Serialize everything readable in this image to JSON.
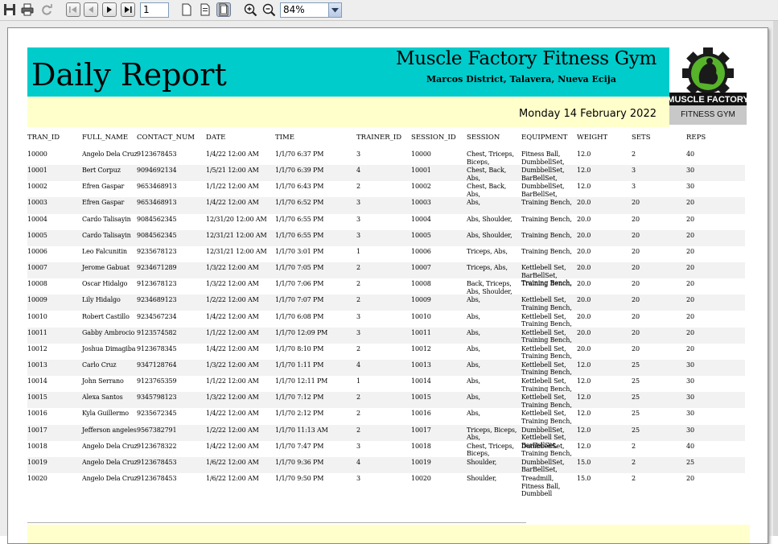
{
  "toolbar": {
    "page_number": "1",
    "zoom": "84%"
  },
  "report": {
    "title": "Daily Report",
    "gym_name": "Muscle Factory Fitness Gym",
    "address": "Marcos District, Talavera, Nueva Ecija",
    "date": "Monday 14 February 2022",
    "logo_text_1": "MUSCLE FACTORY",
    "logo_text_2": "FITNESS GYM"
  },
  "columns": [
    "TRAN_ID",
    "FULL_NAME",
    "CONTACT_NUM",
    "DATE",
    "TIME",
    "TRAINER_ID",
    "SESSION_ID",
    "SESSION",
    "EQUIPMENT",
    "WEIGHT",
    "SETS",
    "REPS"
  ],
  "rows": [
    {
      "id": "10000",
      "name": "Angelo Dela Cruz",
      "contact": "9123678453",
      "date": "1/4/22 12:00 AM",
      "time": "1/1/70 6:37 PM",
      "trainer": "3",
      "session_id": "10000",
      "session": "Chest, Triceps, Biceps,",
      "equipment": "Fitness Ball, DumbbellSet, Training Bench,",
      "weight": "12.0",
      "sets": "2",
      "reps": "40"
    },
    {
      "id": "10001",
      "name": "Bert Corpuz",
      "contact": "9094692134",
      "date": "1/5/21 12:00 AM",
      "time": "1/1/70 6:39 PM",
      "trainer": "4",
      "session_id": "10001",
      "session": "Chest, Back, Abs,",
      "equipment": "DumbbellSet, BarBellSet,",
      "weight": "12.0",
      "sets": "3",
      "reps": "30"
    },
    {
      "id": "10002",
      "name": "Efren Gaspar",
      "contact": "9653468913",
      "date": "1/1/22 12:00 AM",
      "time": "1/1/70 6:43 PM",
      "trainer": "2",
      "session_id": "10002",
      "session": "Chest, Back, Abs,",
      "equipment": "DumbbellSet, BarBellSet,",
      "weight": "12.0",
      "sets": "3",
      "reps": "30"
    },
    {
      "id": "10003",
      "name": "Efren Gaspar",
      "contact": "9653468913",
      "date": "1/4/22 12:00 AM",
      "time": "1/1/70 6:52 PM",
      "trainer": "3",
      "session_id": "10003",
      "session": "Abs,",
      "equipment": "Training Bench,",
      "weight": "20.0",
      "sets": "20",
      "reps": "20"
    },
    {
      "id": "10004",
      "name": "Cardo Talisayin",
      "contact": "9084562345",
      "date": "12/31/20 12:00 AM",
      "time": "1/1/70 6:55 PM",
      "trainer": "3",
      "session_id": "10004",
      "session": "Abs, Shoulder,",
      "equipment": "Training Bench,",
      "weight": "20.0",
      "sets": "20",
      "reps": "20"
    },
    {
      "id": "10005",
      "name": "Cardo Talisayin",
      "contact": "9084562345",
      "date": "12/31/21 12:00 AM",
      "time": "1/1/70 6:55 PM",
      "trainer": "3",
      "session_id": "10005",
      "session": "Abs, Shoulder,",
      "equipment": "Training Bench,",
      "weight": "20.0",
      "sets": "20",
      "reps": "20"
    },
    {
      "id": "10006",
      "name": "Leo Falcunitin",
      "contact": "9235678123",
      "date": "12/31/21 12:00 AM",
      "time": "1/1/70 3:01 PM",
      "trainer": "1",
      "session_id": "10006",
      "session": "Triceps, Abs,",
      "equipment": "Training Bench,",
      "weight": "20.0",
      "sets": "20",
      "reps": "20"
    },
    {
      "id": "10007",
      "name": "Jerome Gabuat",
      "contact": "9234671289",
      "date": "1/3/22 12:00 AM",
      "time": "1/1/70 7:05 PM",
      "trainer": "2",
      "session_id": "10007",
      "session": "Triceps, Abs,",
      "equipment": "Kettlebell Set, BarBellSet, Training Bench,",
      "weight": "20.0",
      "sets": "20",
      "reps": "20"
    },
    {
      "id": "10008",
      "name": "Oscar Hidalgo",
      "contact": "9123678123",
      "date": "1/3/22 12:00 AM",
      "time": "1/1/70 7:06 PM",
      "trainer": "2",
      "session_id": "10008",
      "session": "Back, Triceps, Abs, Shoulder,",
      "equipment": "Training Bench,",
      "weight": "20.0",
      "sets": "20",
      "reps": "20"
    },
    {
      "id": "10009",
      "name": "Lily Hidalgo",
      "contact": "9234689123",
      "date": "1/2/22 12:00 AM",
      "time": "1/1/70 7:07 PM",
      "trainer": "2",
      "session_id": "10009",
      "session": "Abs,",
      "equipment": "Kettlebell Set, Training Bench,",
      "weight": "20.0",
      "sets": "20",
      "reps": "20"
    },
    {
      "id": "10010",
      "name": "Robert Castillo",
      "contact": "9234567234",
      "date": "1/4/22 12:00 AM",
      "time": "1/1/70 6:08 PM",
      "trainer": "3",
      "session_id": "10010",
      "session": "Abs,",
      "equipment": "Kettlebell Set, Training Bench,",
      "weight": "20.0",
      "sets": "20",
      "reps": "20"
    },
    {
      "id": "10011",
      "name": "Gabby Ambrocio",
      "contact": "9123574582",
      "date": "1/1/22 12:00 AM",
      "time": "1/1/70 12:09 PM",
      "trainer": "3",
      "session_id": "10011",
      "session": "Abs,",
      "equipment": "Kettlebell Set, Training Bench,",
      "weight": "20.0",
      "sets": "20",
      "reps": "20"
    },
    {
      "id": "10012",
      "name": "Joshua Dimagiba",
      "contact": "9123678345",
      "date": "1/4/22 12:00 AM",
      "time": "1/1/70 8:10 PM",
      "trainer": "2",
      "session_id": "10012",
      "session": "Abs,",
      "equipment": "Kettlebell Set, Training Bench,",
      "weight": "20.0",
      "sets": "20",
      "reps": "20"
    },
    {
      "id": "10013",
      "name": "Carlo Cruz",
      "contact": "9347128764",
      "date": "1/3/22 12:00 AM",
      "time": "1/1/70 1:11 PM",
      "trainer": "4",
      "session_id": "10013",
      "session": "Abs,",
      "equipment": "Kettlebell Set, Training Bench,",
      "weight": "12.0",
      "sets": "25",
      "reps": "30"
    },
    {
      "id": "10014",
      "name": "John Serrano",
      "contact": "9123765359",
      "date": "1/1/22 12:00 AM",
      "time": "1/1/70 12:11 PM",
      "trainer": "1",
      "session_id": "10014",
      "session": "Abs,",
      "equipment": "Kettlebell Set, Training Bench,",
      "weight": "12.0",
      "sets": "25",
      "reps": "30"
    },
    {
      "id": "10015",
      "name": "Alexa Santos",
      "contact": "9345798123",
      "date": "1/3/22 12:00 AM",
      "time": "1/1/70 7:12 PM",
      "trainer": "2",
      "session_id": "10015",
      "session": "Abs,",
      "equipment": "Kettlebell Set, Training Bench,",
      "weight": "12.0",
      "sets": "25",
      "reps": "30"
    },
    {
      "id": "10016",
      "name": "Kyla Guillermo",
      "contact": "9235672345",
      "date": "1/4/22 12:00 AM",
      "time": "1/1/70 2:12 PM",
      "trainer": "2",
      "session_id": "10016",
      "session": "Abs,",
      "equipment": "Kettlebell Set, Training Bench,",
      "weight": "12.0",
      "sets": "25",
      "reps": "30"
    },
    {
      "id": "10017",
      "name": "Jefferson angeles",
      "contact": "9567382791",
      "date": "1/2/22 12:00 AM",
      "time": "1/1/70 11:13 AM",
      "trainer": "2",
      "session_id": "10017",
      "session": "Triceps, Biceps, Abs,",
      "equipment": "DumbbellSet, Kettlebell Set, BarBellSet,",
      "weight": "12.0",
      "sets": "25",
      "reps": "30"
    },
    {
      "id": "10018",
      "name": "Angelo Dela Cruz",
      "contact": "9123678322",
      "date": "1/4/22 12:00 AM",
      "time": "1/1/70 7:47 PM",
      "trainer": "3",
      "session_id": "10018",
      "session": "Chest, Triceps, Biceps,",
      "equipment": "DumbbellSet, Training Bench,",
      "weight": "12.0",
      "sets": "2",
      "reps": "40"
    },
    {
      "id": "10019",
      "name": "Angelo Dela Cruz",
      "contact": "9123678453",
      "date": "1/6/22 12:00 AM",
      "time": "1/1/70 9:36 PM",
      "trainer": "4",
      "session_id": "10019",
      "session": "Shoulder,",
      "equipment": "DumbbellSet, BarBellSet,",
      "weight": "15.0",
      "sets": "2",
      "reps": "25"
    },
    {
      "id": "10020",
      "name": "Angelo Dela Cruz",
      "contact": "9123678453",
      "date": "1/6/22 12:00 AM",
      "time": "1/1/70 9:50 PM",
      "trainer": "3",
      "session_id": "10020",
      "session": "Shoulder,",
      "equipment": "Treadmill, Fitness Ball, Dumbbell",
      "weight": "15.0",
      "sets": "2",
      "reps": "20"
    }
  ]
}
